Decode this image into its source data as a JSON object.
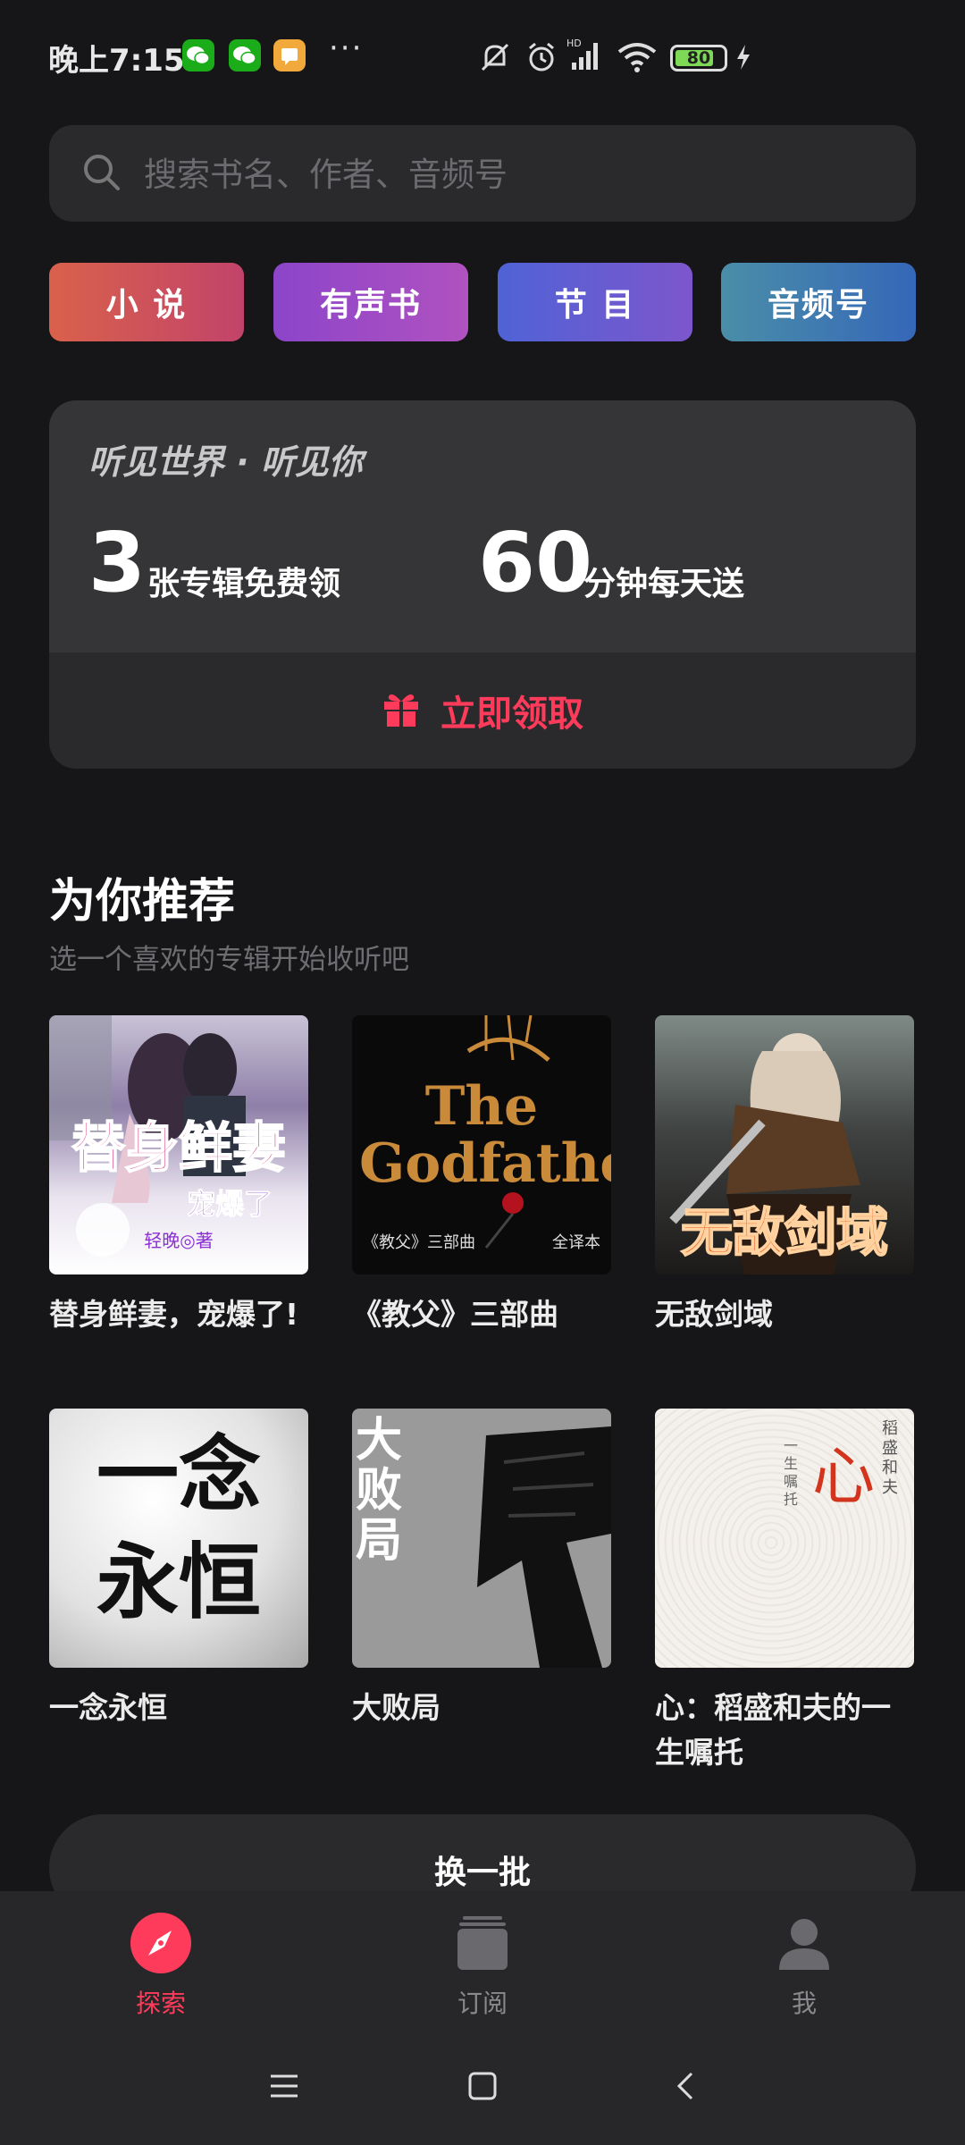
{
  "status_bar": {
    "time": "晚上7:15",
    "apps": [
      "wechat-icon",
      "wechat-icon",
      "message-icon"
    ],
    "more": "···",
    "battery": "80",
    "battery_fraction": 0.8,
    "network": "HD"
  },
  "search": {
    "placeholder": "搜索书名、作者、音频号"
  },
  "categories": [
    {
      "label": "小 说",
      "colors": [
        "#d9614b",
        "#c2436a"
      ]
    },
    {
      "label": "有声书",
      "colors": [
        "#8c45c9",
        "#b052c0"
      ]
    },
    {
      "label": "节 目",
      "colors": [
        "#4f63d6",
        "#7d56cc"
      ]
    },
    {
      "label": "音频号",
      "colors": [
        "#4a8ea8",
        "#3567b8"
      ]
    }
  ],
  "promo": {
    "slogan": "听见世界 · 听见你",
    "num1": "3",
    "unit1": "张专辑免费领",
    "num2": "60",
    "unit2": "分钟每天送",
    "cta": "立即领取",
    "accent": "#ff3b5c"
  },
  "recommend": {
    "title": "为你推荐",
    "subtitle": "选一个喜欢的专辑开始收听吧",
    "albums": [
      {
        "title": "替身鲜妻，宠爆了!",
        "cover_text": "替身鲜妻",
        "cover_sub": "宠爆了",
        "cover_author": "轻晚◎著"
      },
      {
        "title": "《教父》三部曲",
        "cover_text": "The Godfather",
        "cover_sub": "《教父》三部曲",
        "cover_author": "全译本"
      },
      {
        "title": "无敌剑域",
        "cover_text": "无敌剑域"
      },
      {
        "title": "一念永恒",
        "cover_text": "一念永恒"
      },
      {
        "title": "大败局",
        "cover_text": "大败局"
      },
      {
        "title": "心：稻盛和夫的一生嘱托",
        "cover_text": "心",
        "cover_sub": "稻盛和夫",
        "cover_author": "一生嘱托"
      }
    ],
    "refresh": "换一批"
  },
  "bottom_nav": [
    {
      "label": "探索",
      "icon": "compass-icon",
      "active": true
    },
    {
      "label": "订阅",
      "icon": "stack-icon",
      "active": false
    },
    {
      "label": "我",
      "icon": "user-icon",
      "active": false
    }
  ]
}
